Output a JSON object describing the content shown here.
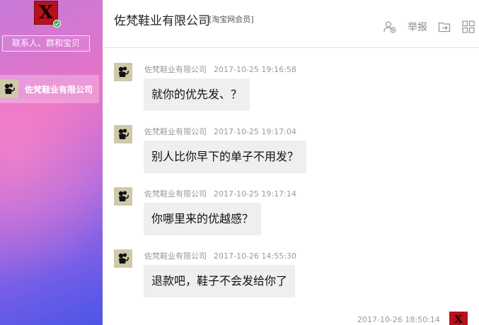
{
  "sidebar": {
    "user_avatar_letter": "X",
    "search_placeholder": "联系人、群和宝贝",
    "contact": {
      "name": "佐梵鞋业有限公司"
    }
  },
  "header": {
    "title": "佐梵鞋业有限公司",
    "subtitle": "[淘宝网会员]",
    "report_label": "举报",
    "icons": [
      "add-user-icon",
      "report",
      "share-export-icon",
      "grid-apps-icon"
    ]
  },
  "messages": [
    {
      "sender": "佐梵鞋业有限公司",
      "time": "2017-10-25 19:16:58",
      "text": "就你的优先发、？"
    },
    {
      "sender": "佐梵鞋业有限公司",
      "time": "2017-10-25 19:17:04",
      "text": "别人比你早下的单子不用发？"
    },
    {
      "sender": "佐梵鞋业有限公司",
      "time": "2017-10-25 19:17:14",
      "text": "你哪里来的优越感？"
    },
    {
      "sender": "佐梵鞋业有限公司",
      "time": "2017-10-26 14:55:30",
      "text": "退款吧，鞋子不会发给你了"
    }
  ],
  "outgoing": {
    "time": "2017-10-26 18:50:14",
    "avatar_letter": "X"
  },
  "colors": {
    "sidebar_gradient_start": "#c77ad8",
    "sidebar_gradient_end": "#4d55e6",
    "bubble_bg": "#efefef",
    "online_green": "#33b34a",
    "brand_red": "#b5121b"
  }
}
